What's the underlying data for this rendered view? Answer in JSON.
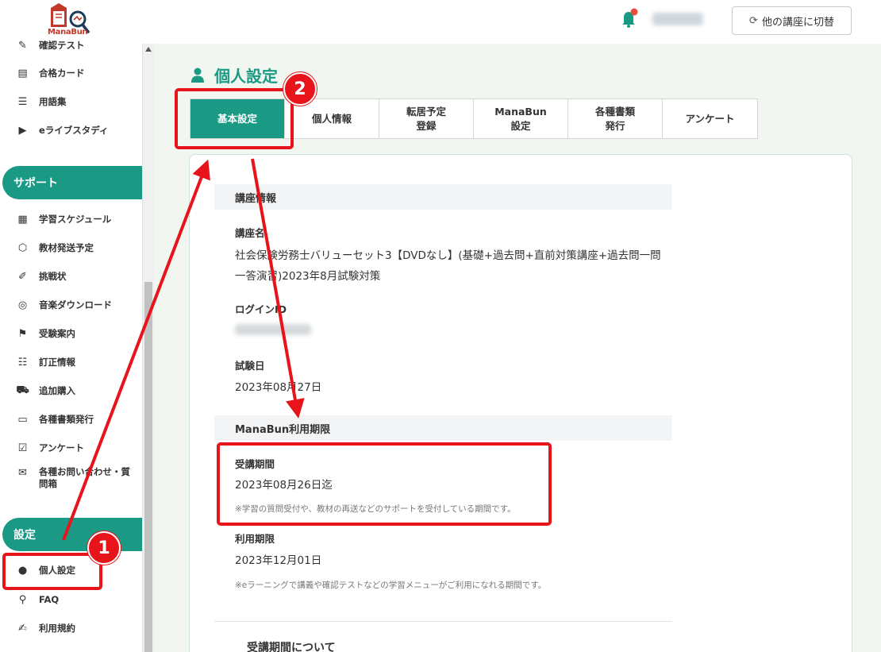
{
  "header": {
    "logo_text": "ManaBun",
    "switch_button": "他の講座に切替"
  },
  "sidebar": {
    "items_top": [
      {
        "label": "確認テスト",
        "icon": "pen-icon"
      },
      {
        "label": "合格カード",
        "icon": "cards-icon"
      },
      {
        "label": "用語集",
        "icon": "book-stack-icon"
      },
      {
        "label": "eライブスタディ",
        "icon": "video-icon"
      }
    ],
    "support_heading": "サポート",
    "support_items": [
      {
        "label": "学習スケジュール",
        "icon": "calendar-icon"
      },
      {
        "label": "教材発送予定",
        "icon": "box-icon"
      },
      {
        "label": "挑戦状",
        "icon": "wand-icon"
      },
      {
        "label": "音楽ダウンロード",
        "icon": "disc-icon"
      },
      {
        "label": "受験案内",
        "icon": "flag-icon"
      },
      {
        "label": "訂正情報",
        "icon": "document-icon"
      },
      {
        "label": "追加購入",
        "icon": "cart-icon"
      },
      {
        "label": "各種書類発行",
        "icon": "file-icon"
      },
      {
        "label": "アンケート",
        "icon": "checkbox-icon"
      },
      {
        "label": "各種お問い合わせ・質問箱",
        "icon": "mail-icon"
      }
    ],
    "settings_heading": "設定",
    "settings_items": [
      {
        "label": "個人設定",
        "icon": "user-icon"
      },
      {
        "label": "FAQ",
        "icon": "magnifier-icon"
      },
      {
        "label": "利用規約",
        "icon": "edit-icon"
      }
    ]
  },
  "page": {
    "title": "個人設定",
    "tabs": [
      {
        "label": "基本設定",
        "active": true
      },
      {
        "label": "個人情報",
        "active": false
      },
      {
        "label": "転居予定\n登録",
        "active": false
      },
      {
        "label": "ManaBun\n設定",
        "active": false
      },
      {
        "label": "各種書類\n発行",
        "active": false
      },
      {
        "label": "アンケート",
        "active": false
      }
    ]
  },
  "content": {
    "course_info": {
      "heading": "講座情報",
      "course_name_label": "講座名",
      "course_name_value": "社会保険労務士バリューセット3【DVDなし】(基礎+過去問+直前対策講座+過去問一問一答演習)2023年8月試験対策",
      "login_id_label": "ログインID",
      "exam_date_label": "試験日",
      "exam_date_value": "2023年08月27日"
    },
    "usage_limit": {
      "heading": "ManaBun利用期限",
      "course_period_label": "受講期間",
      "course_period_value": "2023年08月26日迄",
      "course_period_note": "※学習の質問受付や、教材の再送などのサポートを受付している期間です。",
      "usage_period_label": "利用期限",
      "usage_period_value": "2023年12月01日",
      "usage_period_note": "※eラーニングで講義や確認テストなどの学習メニューがご利用になれる期間です。"
    },
    "about_heading": "受講期間について"
  },
  "annotations": {
    "badge_1": "1",
    "badge_2": "2"
  },
  "colors": {
    "brand": "#1a9a85",
    "highlight": "#e8141b"
  }
}
